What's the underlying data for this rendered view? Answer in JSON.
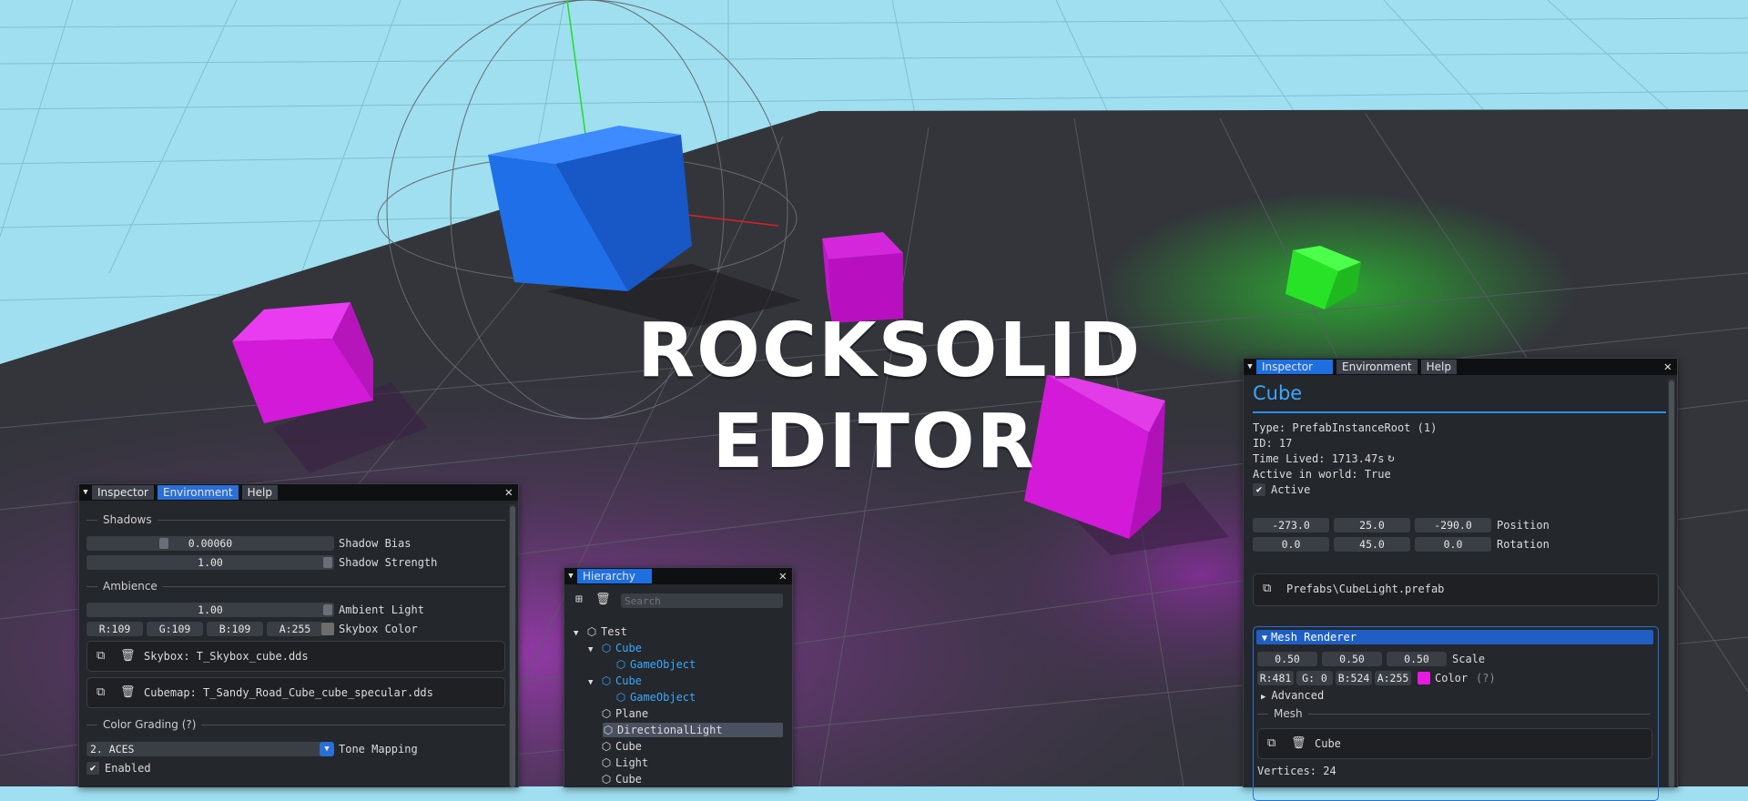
{
  "title": {
    "line1": "ROCKSOLID",
    "line2": "EDITOR"
  },
  "colors": {
    "sky": "#9fdff0",
    "ground": "#33353b",
    "magenta": "#d81ae0",
    "blue_cube": "#1f72ef",
    "green_cube": "#24e025",
    "accent": "#2a6fd6",
    "window_bg": "#24272b"
  },
  "env_window": {
    "tabs": [
      "Inspector",
      "Environment",
      "Help"
    ],
    "active_tab": "Environment",
    "shadows": {
      "header": "Shadows",
      "bias_value": "0.00060",
      "bias_label": "Shadow Bias",
      "strength_value": "1.00",
      "strength_label": "Shadow Strength"
    },
    "ambience": {
      "header": "Ambience",
      "light_value": "1.00",
      "light_label": "Ambient Light",
      "r": "R:109",
      "g": "G:109",
      "b": "B:109",
      "a": "A:255",
      "color_label": "Skybox Color"
    },
    "skybox": "Skybox: T_Skybox_cube.dds",
    "cubemap": "Cubemap: T_Sandy_Road_Cube_cube_specular.dds",
    "grading": {
      "header": "Color Grading (?)",
      "mapping_value": "2. ACES",
      "mapping_label": "Tone Mapping",
      "enabled_label": "Enabled"
    }
  },
  "hierarchy": {
    "tab": "Hierarchy",
    "search_placeholder": "Search",
    "items": [
      {
        "label": "Test",
        "depth": 0,
        "arrow": "▼",
        "color": "white"
      },
      {
        "label": "Cube",
        "depth": 1,
        "arrow": "▼",
        "color": "blue"
      },
      {
        "label": "GameObject",
        "depth": 2,
        "arrow": "",
        "color": "blue"
      },
      {
        "label": "Cube",
        "depth": 1,
        "arrow": "▼",
        "color": "blue"
      },
      {
        "label": "GameObject",
        "depth": 2,
        "arrow": "",
        "color": "blue"
      },
      {
        "label": "Plane",
        "depth": 1,
        "arrow": "",
        "color": "white"
      },
      {
        "label": "DirectionalLight",
        "depth": 1,
        "arrow": "",
        "color": "white",
        "selected": true
      },
      {
        "label": "Cube",
        "depth": 1,
        "arrow": "",
        "color": "white"
      },
      {
        "label": "Light",
        "depth": 1,
        "arrow": "",
        "color": "white"
      },
      {
        "label": "Cube",
        "depth": 1,
        "arrow": "",
        "color": "white"
      }
    ]
  },
  "inspector": {
    "tabs": [
      "Inspector",
      "Environment",
      "Help"
    ],
    "active_tab": "Inspector",
    "name": "Cube",
    "type": "Type: PrefabInstanceRoot (1)",
    "id": "ID: 17",
    "time_lived": "Time Lived: 1713.47s",
    "active_in_world": "Active in world: True",
    "active_label": "Active",
    "position": [
      "-273.0",
      "25.0",
      "-290.0"
    ],
    "position_label": "Position",
    "rotation": [
      "0.0",
      "45.0",
      "0.0"
    ],
    "rotation_label": "Rotation",
    "prefab": "Prefabs\\CubeLight.prefab",
    "mesh_renderer": {
      "header": "Mesh Renderer",
      "scale": [
        "0.50",
        "0.50",
        "0.50"
      ],
      "scale_label": "Scale",
      "r": "R:481",
      "g": "G:  0",
      "b": "B:524",
      "a": "A:255",
      "color_label": "Color",
      "color_help": "(?)",
      "color_swatch": "#e61ae0",
      "advanced": "Advanced",
      "mesh_header": "Mesh",
      "mesh_name": "Cube",
      "vertices": "Vertices: 24"
    }
  }
}
